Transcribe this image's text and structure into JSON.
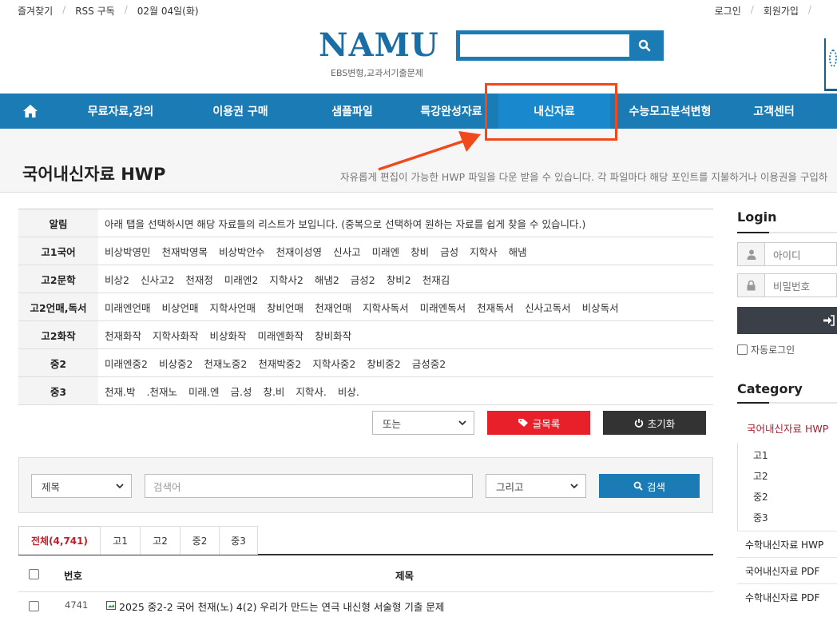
{
  "util": {
    "favorites": "즐겨찾기",
    "rss": "RSS 구독",
    "date": "02월 04일(화)",
    "login": "로그인",
    "join": "회원가입"
  },
  "header": {
    "logo": "NAMU",
    "logo_sub": "EBS변형,교과서기출문제",
    "search_value": ""
  },
  "nav": {
    "items": [
      "무료자료,강의",
      "이용권 구매",
      "샘플파일",
      "특강완성자료",
      "내신자료",
      "수능모고분석변형",
      "고객센터"
    ],
    "active_index": 4
  },
  "page": {
    "title": "국어내신자료 HWP",
    "desc": "자유롭게 편집이 가능한 HWP 파일을 다운 받을 수 있습니다. 각 파일마다 해당 포인트를 지불하거나 이용권을 구입하"
  },
  "filters": [
    {
      "label": "알림",
      "options": [
        "아래 탭을 선택하시면 해당 자료들의 리스트가 보입니다. (중복으로 선택하여 원하는 자료를 쉽게 찾을 수 있습니다.)"
      ]
    },
    {
      "label": "고1국어",
      "options": [
        "비상박영민",
        "천재박영목",
        "비상박안수",
        "천재이성영",
        "신사고",
        "미래엔",
        "창비",
        "금성",
        "지학사",
        "해냄"
      ]
    },
    {
      "label": "고2문학",
      "options": [
        "비상2",
        "신사고2",
        "천재정",
        "미래엔2",
        "지학사2",
        "해냄2",
        "금성2",
        "창비2",
        "천재김"
      ]
    },
    {
      "label": "고2언매,독서",
      "options": [
        "미래엔언매",
        "비상언매",
        "지학사언매",
        "창비언매",
        "천재언매",
        "지학사독서",
        "미래엔독서",
        "천재독서",
        "신사고독서",
        "비상독서"
      ]
    },
    {
      "label": "고2화작",
      "options": [
        "천재화작",
        "지학사화작",
        "비상화작",
        "미래엔화작",
        "창비화작"
      ]
    },
    {
      "label": "중2",
      "options": [
        "미래엔중2",
        "비상중2",
        "천재노중2",
        "천재박중2",
        "지학사중2",
        "창비중2",
        "금성중2"
      ]
    },
    {
      "label": "중3",
      "options": [
        "천재.박",
        ".천재노",
        "미래.엔",
        "금.성",
        "창.비",
        "지학사.",
        "비상."
      ]
    }
  ],
  "controls": {
    "logic_select": "또는",
    "list_button": "글목록",
    "reset_button": "초기화"
  },
  "search": {
    "field_select": "제목",
    "placeholder": "검색어",
    "logic_select": "그리고",
    "button": "검색"
  },
  "tabs": [
    "전체(4,741)",
    "고1",
    "고2",
    "중2",
    "중3"
  ],
  "list": {
    "col_number": "번호",
    "col_title": "제목",
    "rows": [
      {
        "number": "4741",
        "title": "2025 중2-2 국어 천재(노) 4(2) 우리가 만드는 연극 내신형 서술형 기출 문제"
      }
    ]
  },
  "sidebar": {
    "login_title": "Login",
    "id_placeholder": "아이디",
    "pw_placeholder": "비밀번호",
    "auto_login": "자동로그인",
    "category_title": "Category",
    "active_category": "국어내신자료 HWP",
    "sub_categories": [
      "고1",
      "고2",
      "중2",
      "중3"
    ],
    "categories": [
      "수학내신자료 HWP",
      "국어내신자료 PDF",
      "수학내신자료 PDF"
    ]
  },
  "colors": {
    "brand": "#1a7bb5",
    "highlight": "#f04a1c",
    "accent_red": "#e8202a",
    "active_text": "#b01a30"
  }
}
